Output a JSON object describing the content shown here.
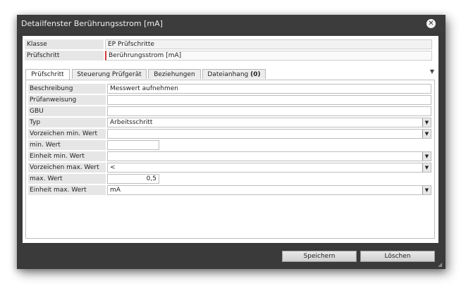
{
  "window": {
    "title": "Detailfenster Berührungsstrom [mA]"
  },
  "header": {
    "klasse_label": "Klasse",
    "klasse_value": "EP Prüfschritte",
    "pruefschritt_label": "Prüfschritt",
    "pruefschritt_value": "Berührungsstrom [mA]"
  },
  "tabs": [
    {
      "label": "Prüfschritt"
    },
    {
      "label": "Steuerung Prüfgerät"
    },
    {
      "label": "Beziehungen"
    },
    {
      "label": "Dateianhang",
      "count": "(0)"
    }
  ],
  "form": {
    "beschreibung_label": "Beschreibung",
    "beschreibung_value": "Messwert aufnehmen",
    "pruefanweisung_label": "Prüfanweisung",
    "pruefanweisung_value": "",
    "gbu_label": "GBU",
    "gbu_value": "",
    "typ_label": "Typ",
    "typ_value": "Arbeitsschritt",
    "vorzeichen_min_label": "Vorzeichen min. Wert",
    "vorzeichen_min_value": "",
    "min_wert_label": "min. Wert",
    "min_wert_value": "",
    "einheit_min_label": "Einheit min. Wert",
    "einheit_min_value": "",
    "vorzeichen_max_label": "Vorzeichen max. Wert",
    "vorzeichen_max_value": "<",
    "max_wert_label": "max. Wert",
    "max_wert_value": "0,5",
    "einheit_max_label": "Einheit max. Wert",
    "einheit_max_value": "mA"
  },
  "footer": {
    "save_label": "Speichern",
    "delete_label": "Löschen"
  },
  "icons": {
    "close": "close-icon",
    "dropdown": "chevron-down-icon",
    "resize": "resize-grip-icon"
  }
}
